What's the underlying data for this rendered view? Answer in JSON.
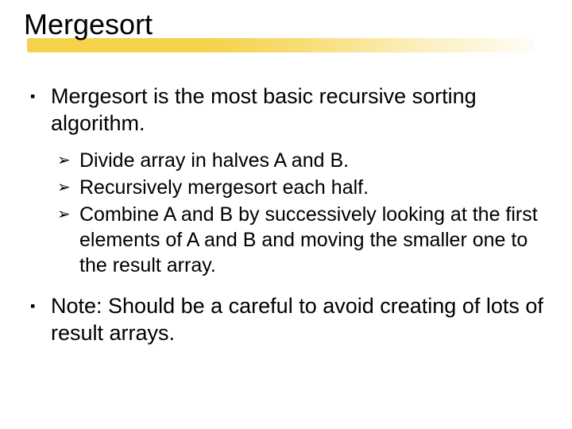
{
  "title": "Mergesort",
  "bullets": {
    "p1": "Mergesort is the most basic recursive sorting algorithm.",
    "sub": [
      "Divide array in halves A and B.",
      "Recursively mergesort each half.",
      "Combine A and B by successively looking at the first elements of A and B and moving the smaller one to the result array."
    ],
    "p2": "Note: Should be a careful to avoid creating of lots of result arrays."
  },
  "glyphs": {
    "square": "▪",
    "arrow": "➢"
  }
}
